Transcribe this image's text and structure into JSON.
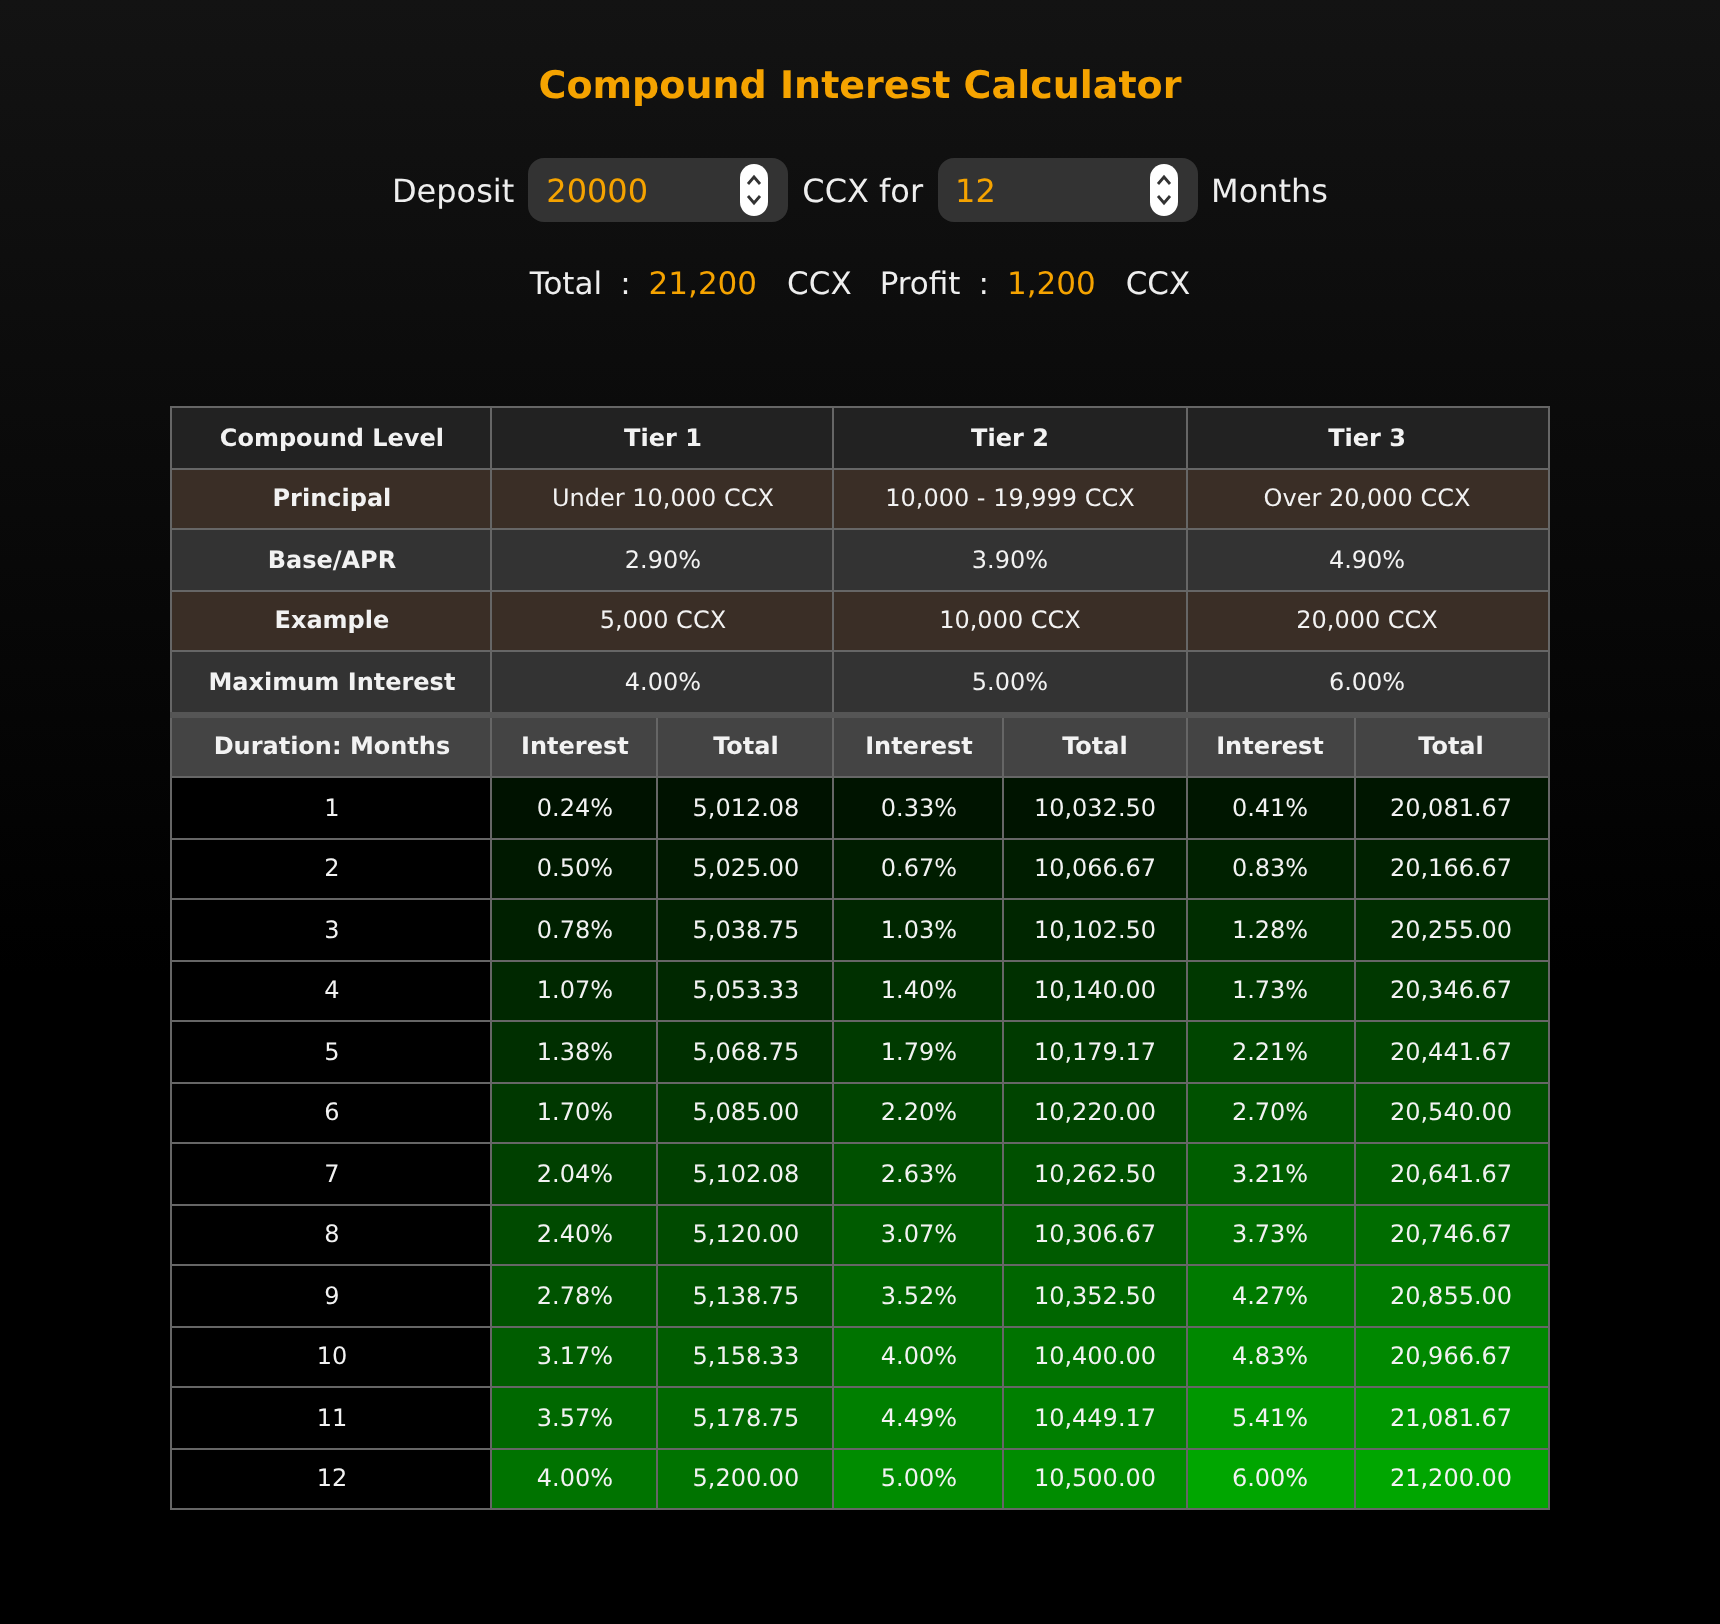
{
  "title": "Compound Interest Calculator",
  "calculator": {
    "deposit_label": "Deposit",
    "deposit": {
      "value": "20000"
    },
    "unit_label": "CCX for",
    "months": {
      "value": "12"
    },
    "months_label": "Months"
  },
  "summary": [
    {
      "label": "Total",
      "separator": ":",
      "value": "21,200",
      "unit": "CCX"
    },
    {
      "label": "Profit",
      "separator": ":",
      "value": "1,200",
      "unit": "CCX"
    }
  ],
  "table": {
    "header": [
      "Compound Level",
      "Tier 1",
      "Tier 2",
      "Tier 3"
    ],
    "info_rows": [
      [
        "Principal",
        "Under 10,000 CCX",
        "10,000 - 19,999 CCX",
        "Over 20,000 CCX"
      ],
      [
        "Base/APR",
        "2.90%",
        "3.90%",
        "4.90%"
      ],
      [
        "Example",
        "5,000 CCX",
        "10,000 CCX",
        "20,000 CCX"
      ],
      [
        "Maximum Interest",
        "4.00%",
        "5.00%",
        "6.00%"
      ]
    ],
    "columns": [
      "Duration: Months",
      "Interest",
      "Total",
      "Interest",
      "Total",
      "Interest",
      "Total"
    ],
    "rows": [
      {
        "month": "1",
        "tiers": [
          {
            "interest": "0.24%",
            "total": "5,012.08",
            "color": "#001200"
          },
          {
            "interest": "0.33%",
            "total": "10,032.50",
            "color": "#001400"
          },
          {
            "interest": "0.41%",
            "total": "20,081.67",
            "color": "#001600"
          }
        ]
      },
      {
        "month": "2",
        "tiers": [
          {
            "interest": "0.50%",
            "total": "5,025.00",
            "color": "#001900"
          },
          {
            "interest": "0.67%",
            "total": "10,066.67",
            "color": "#001d00"
          },
          {
            "interest": "0.83%",
            "total": "20,166.67",
            "color": "#002100"
          }
        ]
      },
      {
        "month": "3",
        "tiers": [
          {
            "interest": "0.78%",
            "total": "5,038.75",
            "color": "#002000"
          },
          {
            "interest": "1.03%",
            "total": "10,102.50",
            "color": "#002600"
          },
          {
            "interest": "1.28%",
            "total": "20,255.00",
            "color": "#002d00"
          }
        ]
      },
      {
        "month": "4",
        "tiers": [
          {
            "interest": "1.07%",
            "total": "5,053.33",
            "color": "#002800"
          },
          {
            "interest": "1.40%",
            "total": "10,140.00",
            "color": "#003000"
          },
          {
            "interest": "1.73%",
            "total": "20,346.67",
            "color": "#003800"
          }
        ]
      },
      {
        "month": "5",
        "tiers": [
          {
            "interest": "1.38%",
            "total": "5,068.75",
            "color": "#002f00"
          },
          {
            "interest": "1.79%",
            "total": "10,179.17",
            "color": "#003a00"
          },
          {
            "interest": "2.21%",
            "total": "20,441.67",
            "color": "#004500"
          }
        ]
      },
      {
        "month": "6",
        "tiers": [
          {
            "interest": "1.70%",
            "total": "5,085.00",
            "color": "#003800"
          },
          {
            "interest": "2.20%",
            "total": "10,220.00",
            "color": "#004400"
          },
          {
            "interest": "2.70%",
            "total": "20,540.00",
            "color": "#005100"
          }
        ]
      },
      {
        "month": "7",
        "tiers": [
          {
            "interest": "2.04%",
            "total": "5,102.08",
            "color": "#004000"
          },
          {
            "interest": "2.63%",
            "total": "10,262.50",
            "color": "#005000"
          },
          {
            "interest": "3.21%",
            "total": "20,641.67",
            "color": "#005e00"
          }
        ]
      },
      {
        "month": "8",
        "tiers": [
          {
            "interest": "2.40%",
            "total": "5,120.00",
            "color": "#004a00"
          },
          {
            "interest": "3.07%",
            "total": "10,306.67",
            "color": "#005b00"
          },
          {
            "interest": "3.73%",
            "total": "20,746.67",
            "color": "#006c00"
          }
        ]
      },
      {
        "month": "9",
        "tiers": [
          {
            "interest": "2.78%",
            "total": "5,138.75",
            "color": "#005300"
          },
          {
            "interest": "3.52%",
            "total": "10,352.50",
            "color": "#006600"
          },
          {
            "interest": "4.27%",
            "total": "20,855.00",
            "color": "#007a00"
          }
        ]
      },
      {
        "month": "10",
        "tiers": [
          {
            "interest": "3.17%",
            "total": "5,158.33",
            "color": "#005d00"
          },
          {
            "interest": "4.00%",
            "total": "10,400.00",
            "color": "#007300"
          },
          {
            "interest": "4.83%",
            "total": "20,966.67",
            "color": "#008800"
          }
        ]
      },
      {
        "month": "11",
        "tiers": [
          {
            "interest": "3.57%",
            "total": "5,178.75",
            "color": "#006800"
          },
          {
            "interest": "4.49%",
            "total": "10,449.17",
            "color": "#007f00"
          },
          {
            "interest": "5.41%",
            "total": "21,081.67",
            "color": "#009700"
          }
        ]
      },
      {
        "month": "12",
        "tiers": [
          {
            "interest": "4.00%",
            "total": "5,200.00",
            "color": "#007300"
          },
          {
            "interest": "5.00%",
            "total": "10,500.00",
            "color": "#008c00"
          },
          {
            "interest": "6.00%",
            "total": "21,200.00",
            "color": "#00a600"
          }
        ]
      }
    ]
  }
}
